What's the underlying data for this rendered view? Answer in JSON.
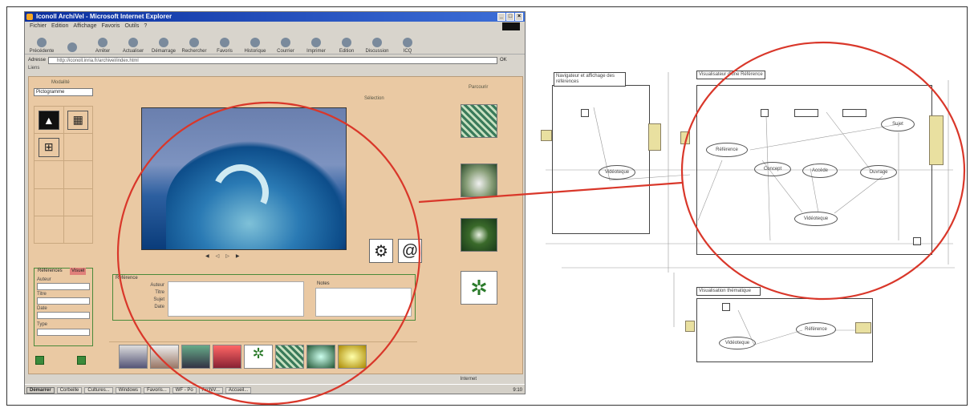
{
  "ie": {
    "title": "Iconoll ArchiVel - Microsoft Internet Explorer",
    "menu": [
      "Fichier",
      "Edition",
      "Affichage",
      "Favoris",
      "Outils",
      "?"
    ],
    "toolbar": [
      "Précédente",
      "",
      "Arrêter",
      "Actualiser",
      "Démarrage",
      "Rechercher",
      "Favoris",
      "Historique",
      "Courrier",
      "Imprimer",
      "Edition",
      "Discussion",
      "ICQ"
    ],
    "address_label": "Adresse",
    "address_value": "http://iconoll.inria.fr/archivel/index.html",
    "go_label": "OK",
    "links_label": "Liens",
    "status_left": "",
    "status_zone": "Internet",
    "taskbar": {
      "start": "Démarrer",
      "tasks": [
        "Corbeille",
        "Cultures...",
        "Windows",
        "Favoris...",
        "WF - Po",
        "ArchiV...",
        "Accueil..."
      ],
      "clock": "9:10"
    }
  },
  "app": {
    "left_panel_title": "Modalité",
    "modality_select": "Pictogramme",
    "ref_tab_1": "Références",
    "ref_tab_2": "Visuel",
    "ref_labels": [
      "Auteur",
      "Titre",
      "Date",
      "Type"
    ],
    "viewer_label": "Sélection",
    "info_label": "Référence",
    "info_rows": [
      "Auteur",
      "Titre",
      "Sujet",
      "Date"
    ],
    "info_notes_label": "Notes",
    "right_col_title": "Parcourir"
  },
  "diagram": {
    "box1_header": "Navigateur et affichage des références",
    "box2_header": "Visualisateur d'une Référence",
    "box3_header": "Visualisation thématique",
    "nodes": [
      "Référence",
      "Concept",
      "Accède",
      "Sujet",
      "Vidéoteque",
      "Ouvrage"
    ],
    "small_node": "Vidéoteque",
    "bottom_nodes": [
      "Référence",
      "Vidéoteque"
    ]
  }
}
